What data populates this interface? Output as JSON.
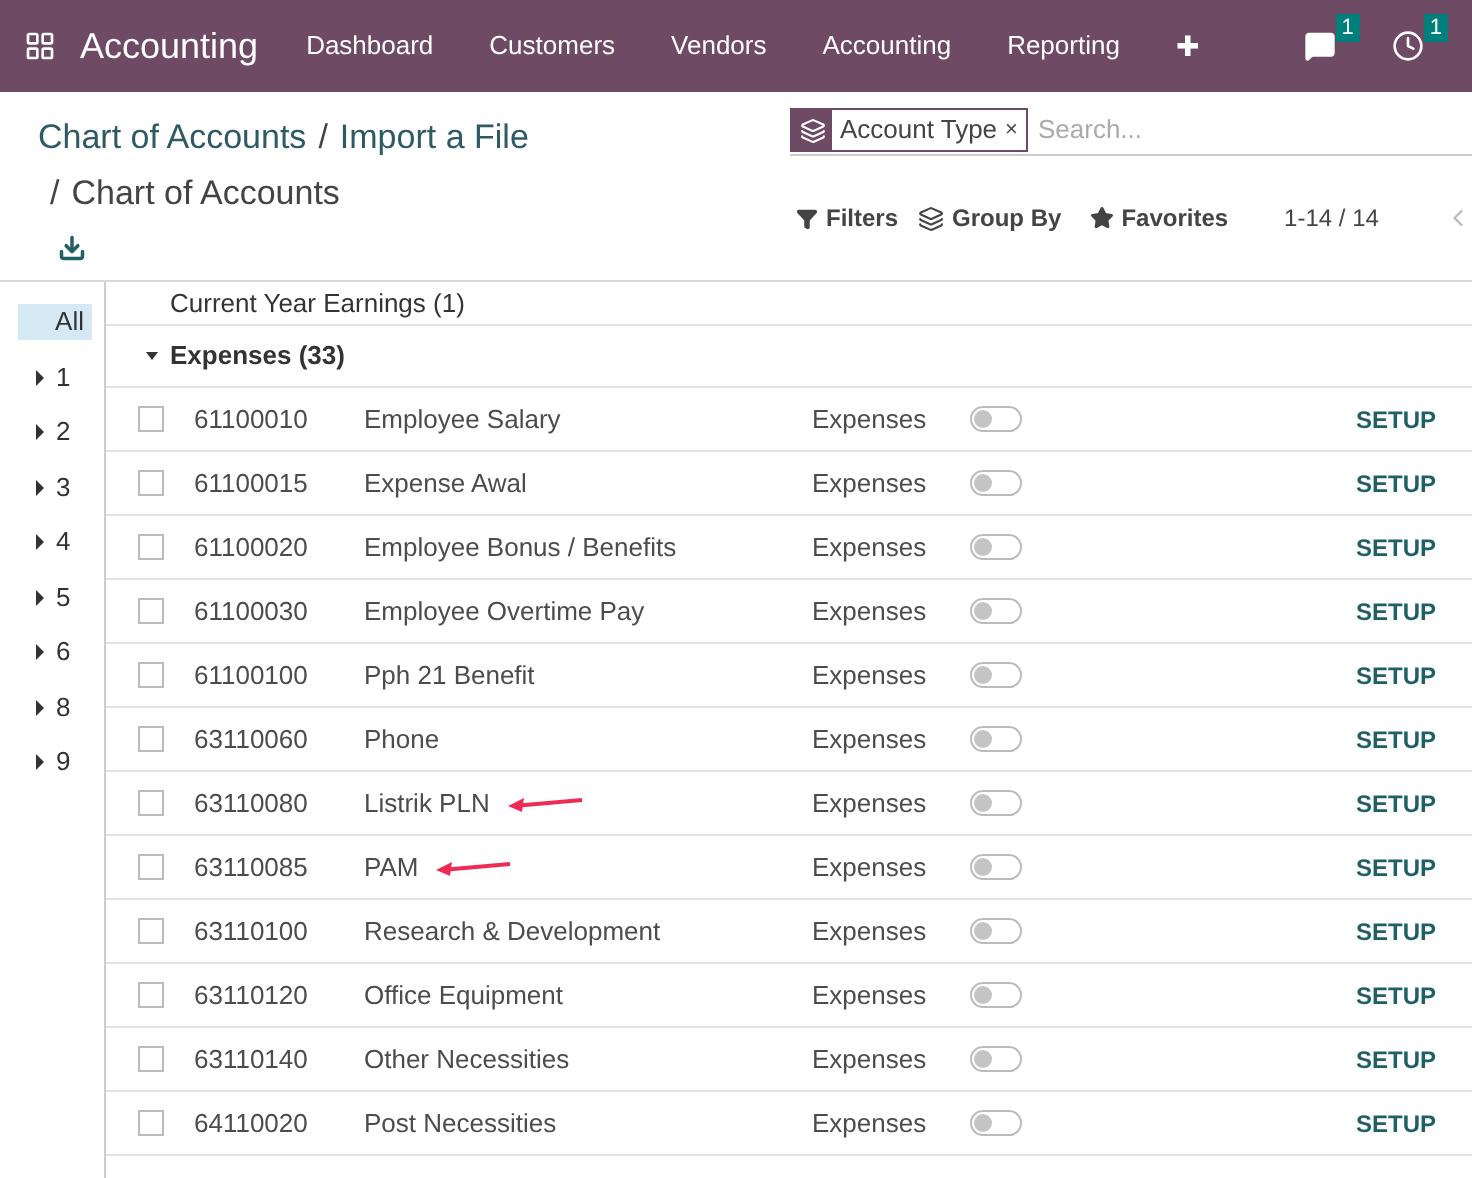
{
  "navbar": {
    "app_name": "Accounting",
    "menu": [
      "Dashboard",
      "Customers",
      "Vendors",
      "Accounting",
      "Reporting"
    ],
    "plus": "✚",
    "messages_count": "1",
    "activities_count": "1"
  },
  "breadcrumbs": {
    "separator": "/",
    "items": [
      {
        "label": "Chart of Accounts",
        "current": false
      },
      {
        "label": "Import a File",
        "current": false
      },
      {
        "label": "Chart of Accounts",
        "current": true
      }
    ]
  },
  "search": {
    "facet": "Account Type",
    "facet_remove": "×",
    "placeholder": "Search..."
  },
  "toolbar": {
    "filters": "Filters",
    "group_by": "Group By",
    "favorites": "Favorites",
    "pager": "1-14 / 14"
  },
  "sidebar": {
    "items": [
      {
        "label": "All",
        "selected": true,
        "has_children": false
      },
      {
        "label": "1",
        "selected": false,
        "has_children": true
      },
      {
        "label": "2",
        "selected": false,
        "has_children": true
      },
      {
        "label": "3",
        "selected": false,
        "has_children": true
      },
      {
        "label": "4",
        "selected": false,
        "has_children": true
      },
      {
        "label": "5",
        "selected": false,
        "has_children": true
      },
      {
        "label": "6",
        "selected": false,
        "has_children": true
      },
      {
        "label": "8",
        "selected": false,
        "has_children": true
      },
      {
        "label": "9",
        "selected": false,
        "has_children": true
      }
    ]
  },
  "groups": [
    {
      "label": "Current Year Earnings (1)",
      "expanded": false
    },
    {
      "label": "Expenses (33)",
      "expanded": true
    }
  ],
  "rows": [
    {
      "code": "61100010",
      "name": "Employee Salary",
      "type": "Expenses",
      "on": false,
      "checked": false,
      "action": "SETUP",
      "arrow": false
    },
    {
      "code": "61100015",
      "name": "Expense Awal",
      "type": "Expenses",
      "on": false,
      "checked": false,
      "action": "SETUP",
      "arrow": false
    },
    {
      "code": "61100020",
      "name": "Employee Bonus / Benefits",
      "type": "Expenses",
      "on": false,
      "checked": false,
      "action": "SETUP",
      "arrow": false
    },
    {
      "code": "61100030",
      "name": "Employee Overtime Pay",
      "type": "Expenses",
      "on": false,
      "checked": false,
      "action": "SETUP",
      "arrow": false
    },
    {
      "code": "61100100",
      "name": "Pph 21 Benefit",
      "type": "Expenses",
      "on": false,
      "checked": false,
      "action": "SETUP",
      "arrow": false
    },
    {
      "code": "63110060",
      "name": "Phone",
      "type": "Expenses",
      "on": false,
      "checked": false,
      "action": "SETUP",
      "arrow": false
    },
    {
      "code": "63110080",
      "name": "Listrik PLN",
      "type": "Expenses",
      "on": false,
      "checked": false,
      "action": "SETUP",
      "arrow": true
    },
    {
      "code": "63110085",
      "name": "PAM",
      "type": "Expenses",
      "on": false,
      "checked": false,
      "action": "SETUP",
      "arrow": true
    },
    {
      "code": "63110100",
      "name": "Research & Development",
      "type": "Expenses",
      "on": false,
      "checked": false,
      "action": "SETUP",
      "arrow": false
    },
    {
      "code": "63110120",
      "name": "Office Equipment",
      "type": "Expenses",
      "on": false,
      "checked": false,
      "action": "SETUP",
      "arrow": false
    },
    {
      "code": "63110140",
      "name": "Other Necessities",
      "type": "Expenses",
      "on": false,
      "checked": false,
      "action": "SETUP",
      "arrow": false
    },
    {
      "code": "64110020",
      "name": "Post Necessities",
      "type": "Expenses",
      "on": false,
      "checked": false,
      "action": "SETUP",
      "arrow": false
    }
  ]
}
